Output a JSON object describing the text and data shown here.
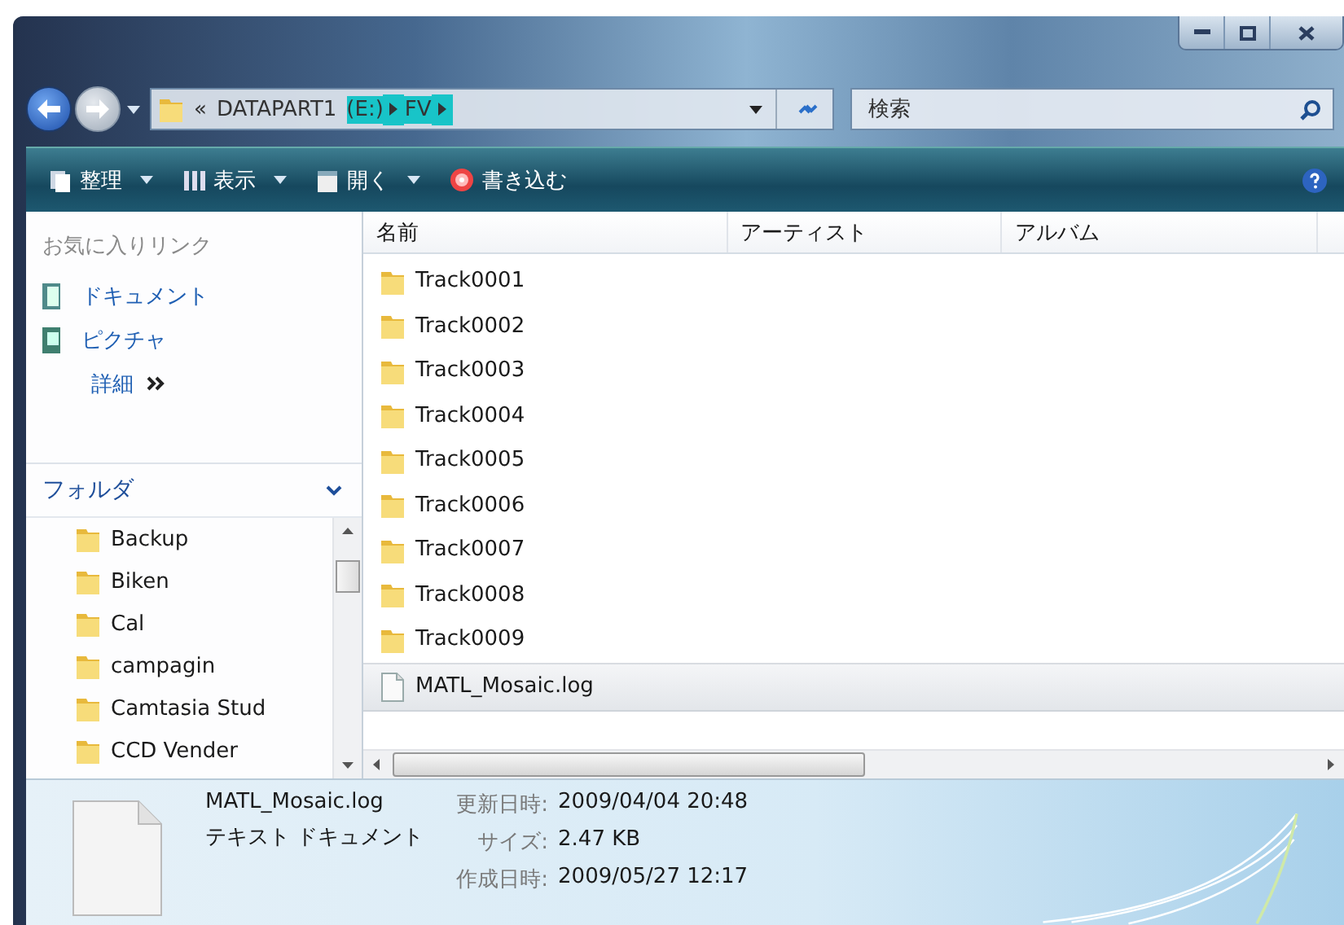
{
  "navigation": {
    "back_disabled": false,
    "forward_disabled": true
  },
  "address": {
    "segments": [
      {
        "label": "«",
        "highlighted": false,
        "arrow": false
      },
      {
        "label": "DATAPART1",
        "highlighted": false,
        "arrow": false
      },
      {
        "label": "(E:)",
        "highlighted": true,
        "arrow": true
      },
      {
        "label": "FV",
        "highlighted": true,
        "arrow": true
      }
    ]
  },
  "search": {
    "placeholder": "検索"
  },
  "toolbar": [
    {
      "label": "整理",
      "kind": "organize",
      "dropdown": true
    },
    {
      "label": "表示",
      "kind": "views",
      "dropdown": true
    },
    {
      "label": "開く",
      "kind": "open",
      "dropdown": true
    },
    {
      "label": "書き込む",
      "kind": "burn",
      "dropdown": false
    }
  ],
  "favorites": {
    "title": "お気に入りリンク",
    "links": [
      {
        "label": "ドキュメント",
        "kind": "documents"
      },
      {
        "label": "ピクチャ",
        "kind": "pictures"
      }
    ],
    "more": "詳細"
  },
  "folders": {
    "title": "フォルダ",
    "expanded": true,
    "items": [
      "Backup",
      "Biken",
      "Cal",
      "campagin",
      "Camtasia Stud",
      "CCD Vender"
    ]
  },
  "file_list": {
    "columns": [
      "名前",
      "アーティスト",
      "アルバム"
    ],
    "rows": [
      {
        "name": "Track0001",
        "kind": "folder",
        "selected": false
      },
      {
        "name": "Track0002",
        "kind": "folder",
        "selected": false
      },
      {
        "name": "Track0003",
        "kind": "folder",
        "selected": false
      },
      {
        "name": "Track0004",
        "kind": "folder",
        "selected": false
      },
      {
        "name": "Track0005",
        "kind": "folder",
        "selected": false
      },
      {
        "name": "Track0006",
        "kind": "folder",
        "selected": false
      },
      {
        "name": "Track0007",
        "kind": "folder",
        "selected": false
      },
      {
        "name": "Track0008",
        "kind": "folder",
        "selected": false
      },
      {
        "name": "Track0009",
        "kind": "folder",
        "selected": false
      },
      {
        "name": "MATL_Mosaic.log",
        "kind": "file",
        "selected": true
      }
    ]
  },
  "details": {
    "name": "MATL_Mosaic.log",
    "type": "テキスト ドキュメント",
    "properties": [
      {
        "label": "更新日時:",
        "value": "2009/04/04 20:48"
      },
      {
        "label": "サイズ:",
        "value": "2.47 KB"
      },
      {
        "label": "作成日時:",
        "value": "2009/05/27 12:17"
      }
    ]
  }
}
